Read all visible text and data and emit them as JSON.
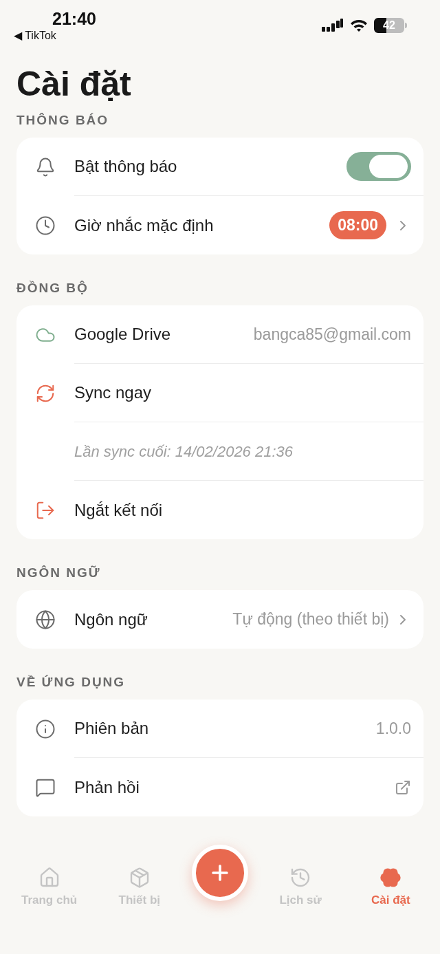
{
  "status_bar": {
    "time": "21:40",
    "back_app": "◀ TikTok",
    "battery": "42"
  },
  "title": "Cài đặt",
  "sections": [
    {
      "header": "THÔNG BÁO",
      "rows": [
        {
          "kind": "toggle",
          "label": "Bật thông báo",
          "on": true
        },
        {
          "kind": "badge",
          "label": "Giờ nhắc mặc định",
          "value": "08:00"
        }
      ]
    },
    {
      "header": "ĐỒNG BỘ",
      "rows": [
        {
          "kind": "value",
          "label": "Google Drive",
          "value": "bangca85@gmail.com"
        },
        {
          "kind": "plain",
          "label": "Sync ngay"
        },
        {
          "kind": "note",
          "label": "Lần sync cuối: 14/02/2026 21:36"
        },
        {
          "kind": "plain",
          "label": "Ngắt kết nối"
        }
      ]
    },
    {
      "header": "NGÔN NGỮ",
      "rows": [
        {
          "kind": "select",
          "label": "Ngôn ngữ",
          "value": "Tự động (theo thiết bị)"
        }
      ]
    },
    {
      "header": "VỀ ỨNG DỤNG",
      "rows": [
        {
          "kind": "value",
          "label": "Phiên bản",
          "value": "1.0.0"
        },
        {
          "kind": "external",
          "label": "Phản hồi"
        }
      ]
    }
  ],
  "tab_bar": [
    {
      "label": "Trang chủ",
      "selected": false
    },
    {
      "label": "Thiết bị",
      "selected": false
    },
    {
      "label": "Lịch sử",
      "selected": false
    },
    {
      "label": "Cài đặt",
      "selected": true
    }
  ]
}
